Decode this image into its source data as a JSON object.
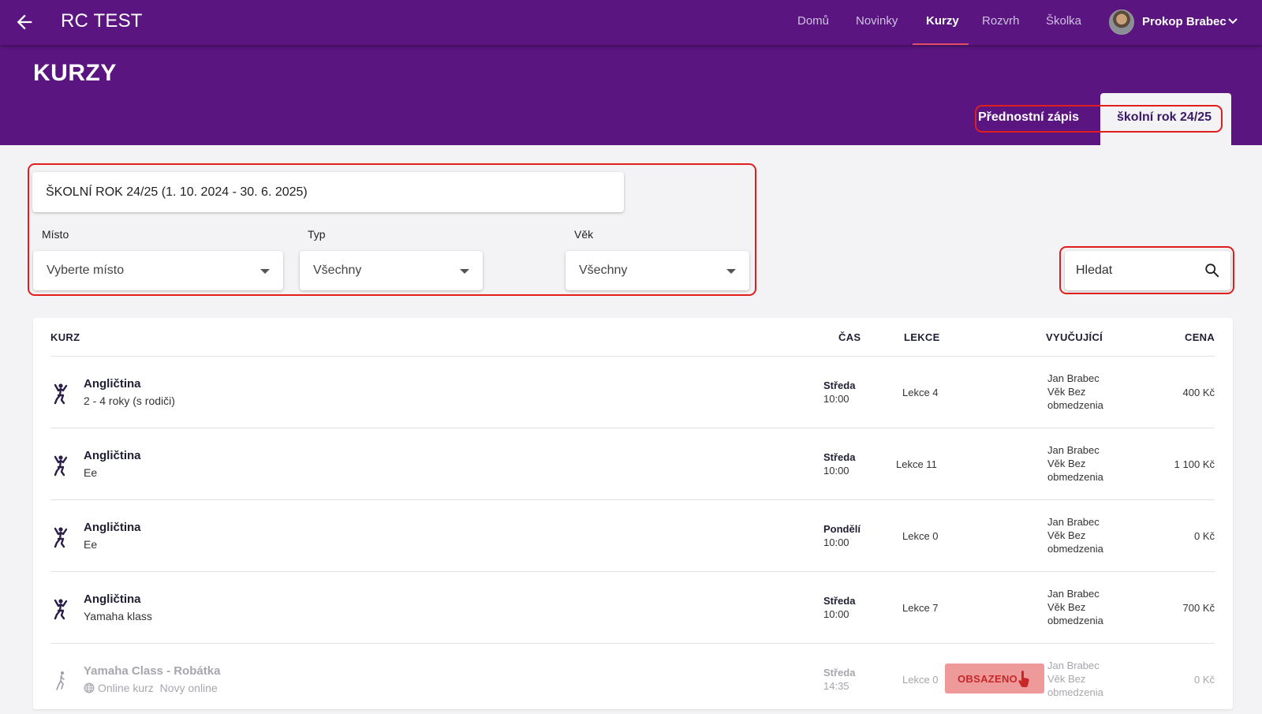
{
  "app": {
    "title": "RC TEST"
  },
  "nav": {
    "items": [
      {
        "label": "Domů",
        "active": false
      },
      {
        "label": "Novinky",
        "active": false
      },
      {
        "label": "Kurzy",
        "active": true
      },
      {
        "label": "Rozvrh",
        "active": false
      },
      {
        "label": "Školka",
        "active": false
      }
    ]
  },
  "user": {
    "name": "Prokop Brabec"
  },
  "page": {
    "title": "KURZY"
  },
  "tabs": [
    {
      "label": "Přednostní zápis",
      "active": false
    },
    {
      "label": "školní rok 24/25",
      "active": true
    }
  ],
  "filters": {
    "year": "ŠKOLNÍ ROK 24/25 (1. 10. 2024 - 30. 6. 2025)",
    "place": {
      "label": "Místo",
      "value": "Vyberte místo"
    },
    "type": {
      "label": "Typ",
      "value": "Všechny"
    },
    "age": {
      "label": "Věk",
      "value": "Všechny"
    }
  },
  "search": {
    "placeholder": "Hledat"
  },
  "table": {
    "headers": {
      "course": "KURZ",
      "time": "ČAS",
      "lessons": "LEKCE",
      "teacher": "VYUČUJÍCÍ",
      "price": "CENA"
    },
    "rows": [
      {
        "name": "Angličtina",
        "sub": "2 - 4 roky (s rodiči)",
        "day": "Středa",
        "time": "10:00",
        "lesson": "Lekce 4",
        "teacher": "Jan Brabec",
        "age1": "Věk Bez",
        "age2": "obmedzenia",
        "price": "400 Kč"
      },
      {
        "name": "Angličtina",
        "sub": "Ee",
        "day": "Středa",
        "time": "10:00",
        "lesson": "Lekce 11",
        "teacher": "Jan Brabec",
        "age1": "Věk Bez",
        "age2": "obmedzenia",
        "price": "1 100 Kč"
      },
      {
        "name": "Angličtina",
        "sub": "Ee",
        "day": "Pondělí",
        "time": "10:00",
        "lesson": "Lekce 0",
        "teacher": "Jan Brabec",
        "age1": "Věk Bez",
        "age2": "obmedzenia",
        "price": "0 Kč"
      },
      {
        "name": "Angličtina",
        "sub": "Yamaha klass",
        "day": "Středa",
        "time": "10:00",
        "lesson": "Lekce 7",
        "teacher": "Jan Brabec",
        "age1": "Věk Bez",
        "age2": "obmedzenia",
        "price": "700 Kč"
      },
      {
        "name": "Yamaha Class - Robátka",
        "sub": "Online kurz  Novy online",
        "day": "Středa",
        "time": "14:35",
        "lesson": "Lekce 0",
        "status": "OBSAZENO",
        "teacher": "Jan Brabec",
        "age1": "Věk Bez",
        "age2": "obmedzenia",
        "price": "0 Kč"
      }
    ]
  },
  "colors": {
    "brand": "#5a1581",
    "highlight": "#e01e1e",
    "occupied_bg": "#ef9a9a",
    "occupied_text": "#c62828"
  }
}
